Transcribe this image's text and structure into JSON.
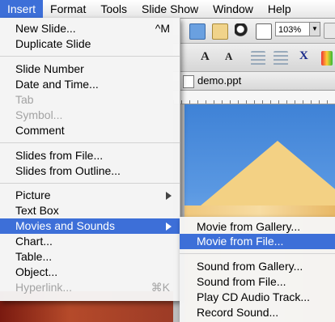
{
  "menubar": {
    "items": [
      {
        "label": "Insert",
        "active": true
      },
      {
        "label": "Format"
      },
      {
        "label": "Tools"
      },
      {
        "label": "Slide Show"
      },
      {
        "label": "Window"
      },
      {
        "label": "Help"
      }
    ]
  },
  "toolbar": {
    "zoom_value": "103%",
    "font_size_up_icon": "A",
    "font_size_down_icon": "A"
  },
  "document": {
    "title": "demo.ppt"
  },
  "insert_menu": {
    "new_slide": {
      "label": "New Slide...",
      "shortcut": "^M"
    },
    "duplicate_slide": {
      "label": "Duplicate Slide"
    },
    "slide_number": {
      "label": "Slide Number"
    },
    "date_time": {
      "label": "Date and Time..."
    },
    "tab": {
      "label": "Tab",
      "disabled": true
    },
    "symbol": {
      "label": "Symbol...",
      "disabled": true
    },
    "comment": {
      "label": "Comment"
    },
    "slides_from_file": {
      "label": "Slides from File..."
    },
    "slides_from_outline": {
      "label": "Slides from Outline..."
    },
    "picture": {
      "label": "Picture"
    },
    "text_box": {
      "label": "Text Box"
    },
    "movies_and_sounds": {
      "label": "Movies and Sounds",
      "highlighted": true
    },
    "chart": {
      "label": "Chart..."
    },
    "table": {
      "label": "Table..."
    },
    "object": {
      "label": "Object..."
    },
    "hyperlink": {
      "label": "Hyperlink...",
      "shortcut": "⌘K",
      "disabled": true
    }
  },
  "movies_submenu": {
    "movie_from_gallery": {
      "label": "Movie from Gallery..."
    },
    "movie_from_file": {
      "label": "Movie from File...",
      "highlighted": true
    },
    "sound_from_gallery": {
      "label": "Sound from Gallery..."
    },
    "sound_from_file": {
      "label": "Sound from File..."
    },
    "play_cd_audio": {
      "label": "Play CD Audio Track..."
    },
    "record_sound": {
      "label": "Record Sound..."
    }
  },
  "colors": {
    "highlight": "#3d6fd8",
    "menu_background": "#f5f5f5",
    "disabled_text": "#a3a3a3"
  }
}
